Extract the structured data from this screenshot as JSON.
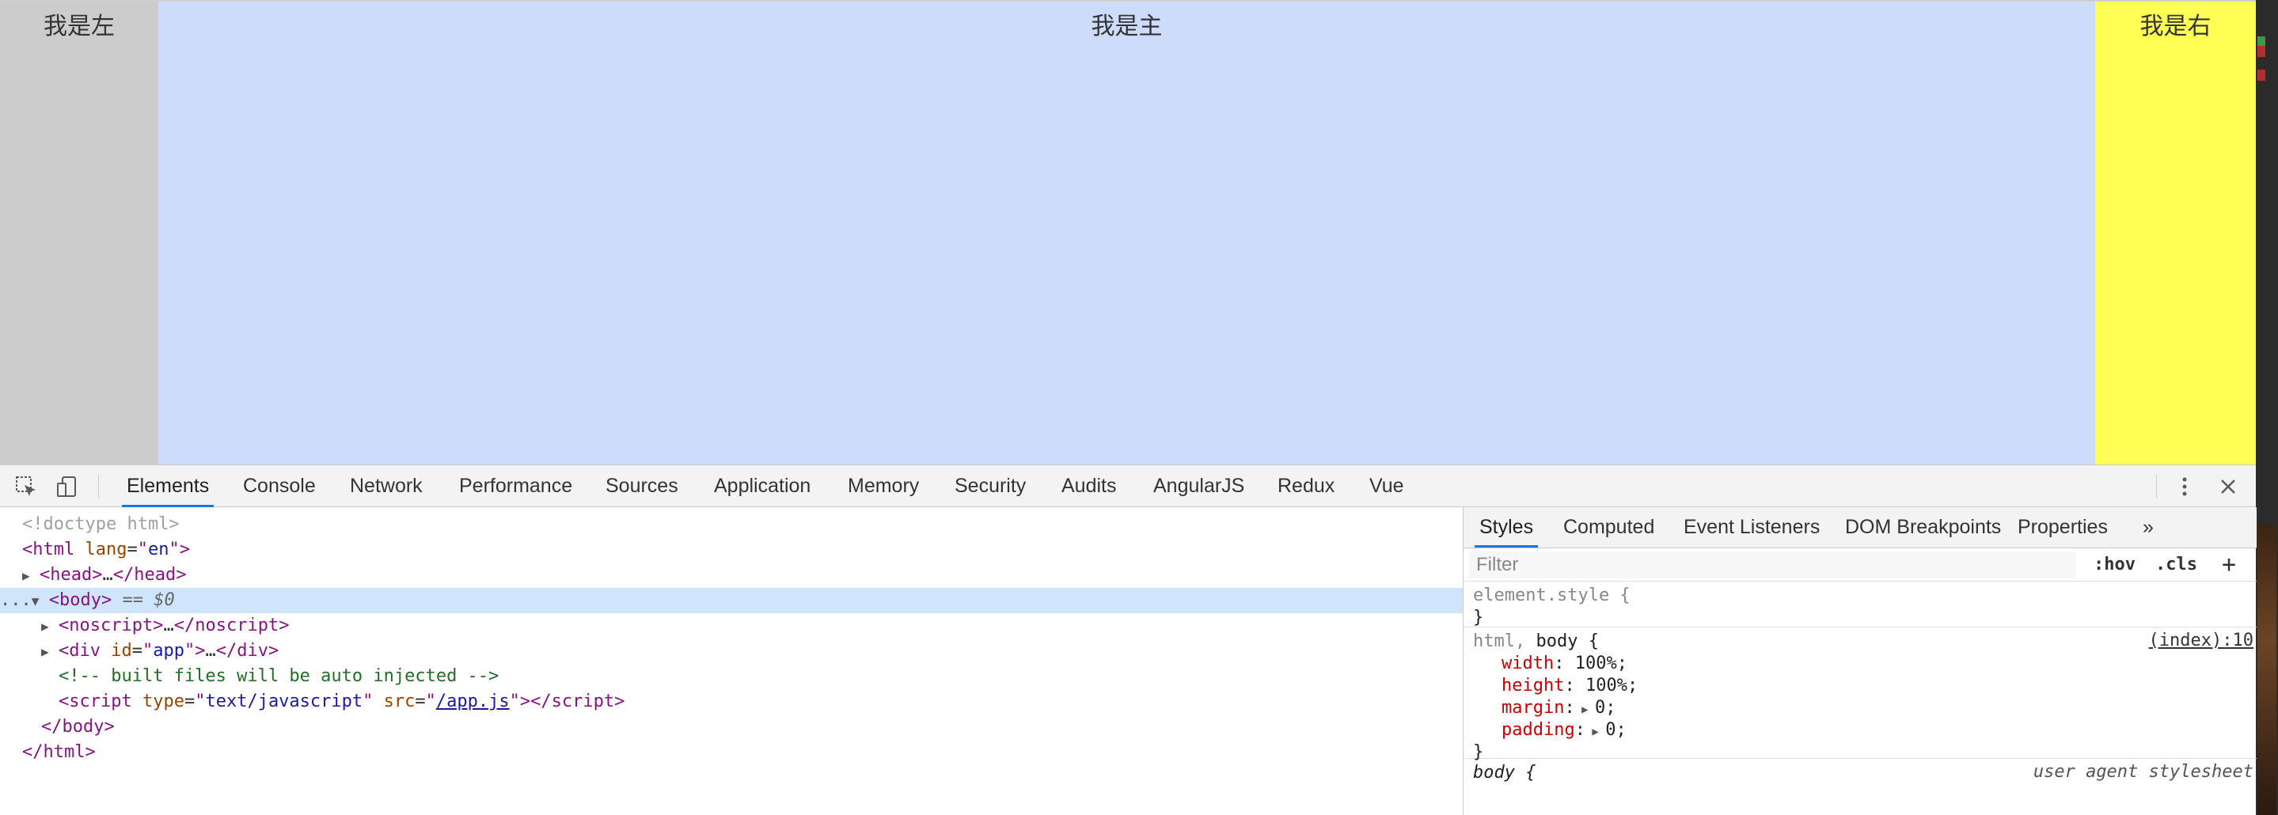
{
  "page": {
    "left_label": "我是左",
    "main_label": "我是主",
    "right_label": "我是右",
    "colors": {
      "left_bg": "#cccccc",
      "main_bg": "#ccdcfa",
      "right_bg": "#ffff55"
    }
  },
  "devtools": {
    "toolbar": {
      "inspect_icon": "inspect-element-icon",
      "device_icon": "device-toolbar-icon",
      "menu_icon": "kebab-menu-icon",
      "close_icon": "close-icon",
      "tabs": [
        {
          "label": "Elements",
          "active": true
        },
        {
          "label": "Console"
        },
        {
          "label": "Network"
        },
        {
          "label": "Performance"
        },
        {
          "label": "Sources"
        },
        {
          "label": "Application"
        },
        {
          "label": "Memory"
        },
        {
          "label": "Security"
        },
        {
          "label": "Audits"
        },
        {
          "label": "AngularJS"
        },
        {
          "label": "Redux"
        },
        {
          "label": "Vue"
        }
      ]
    },
    "elements": {
      "doctype": "<!doctype html>",
      "html_open_tag": "html",
      "html_lang_attr": "lang",
      "html_lang_val": "en",
      "head_tag": "head",
      "body_tag": "body",
      "selected_marker": "== $0",
      "row_dots": "...",
      "noscript_tag": "noscript",
      "div_tag": "div",
      "div_id_attr": "id",
      "div_id_val": "app",
      "comment": "<!-- built files will be auto injected -->",
      "script_tag": "script",
      "script_type_attr": "type",
      "script_type_val": "text/javascript",
      "script_src_attr": "src",
      "script_src_val": "/app.js",
      "ellipsis": "…"
    },
    "styles": {
      "tabs": [
        {
          "label": "Styles",
          "active": true
        },
        {
          "label": "Computed"
        },
        {
          "label": "Event Listeners"
        },
        {
          "label": "DOM Breakpoints"
        },
        {
          "label": "Properties"
        },
        {
          "label": "»"
        }
      ],
      "filter_placeholder": "Filter",
      "hov_label": ":hov",
      "cls_label": ".cls",
      "add_label": "+",
      "element_style_selector": "element.style {",
      "close_brace": "}",
      "rule1_selector_a": "html,",
      "rule1_selector_b": " body {",
      "rule1_source": "(index):10",
      "rule1_props": [
        {
          "name": "width",
          "value": "100%;"
        },
        {
          "name": "height",
          "value": "100%;"
        },
        {
          "name": "margin",
          "value": "0;",
          "expandable": true
        },
        {
          "name": "padding",
          "value": "0;",
          "expandable": true
        }
      ],
      "rule2_selector": "body {",
      "rule2_source": "user agent stylesheet"
    }
  }
}
